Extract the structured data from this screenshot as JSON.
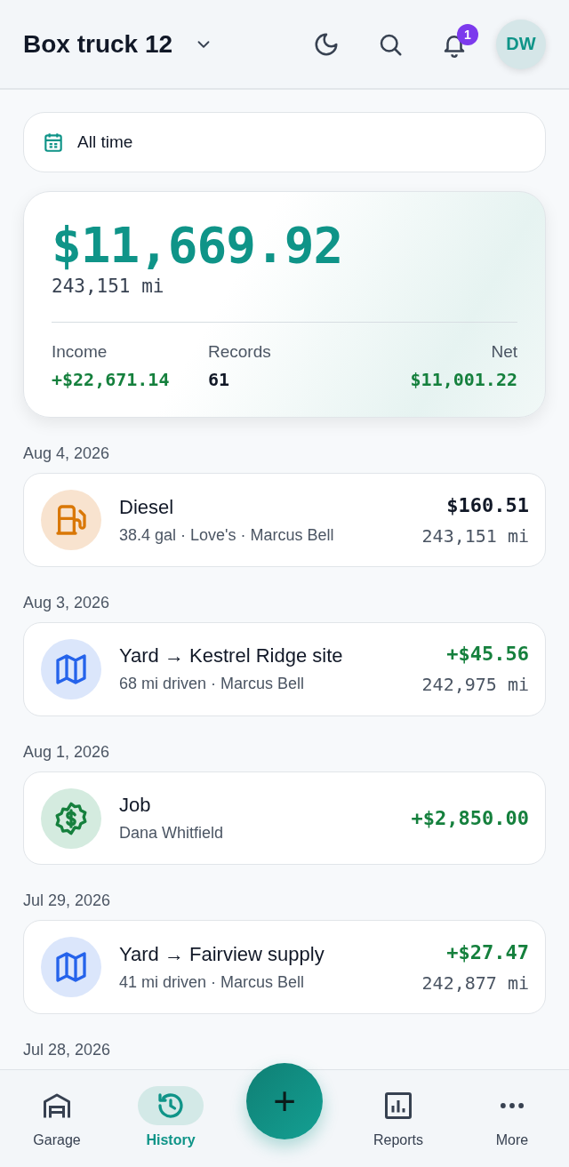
{
  "header": {
    "title": "Box truck 12",
    "notification_count": "1",
    "avatar_initials": "DW"
  },
  "filter": {
    "label": "All time"
  },
  "summary": {
    "total": "$11,669.92",
    "odometer": "243,151 mi",
    "stats": [
      {
        "label": "Income",
        "value": "+$22,671.14",
        "kind": "income"
      },
      {
        "label": "Records",
        "value": "61",
        "kind": "plain"
      },
      {
        "label": "Net",
        "value": "$11,001.22",
        "kind": "income"
      }
    ]
  },
  "groups": [
    {
      "date": "Aug 4, 2026",
      "entries": [
        {
          "kind": "fuel",
          "title": "Diesel",
          "subtitle": "38.4 gal · Love's · Marcus Bell",
          "amount": "$160.51",
          "income": false,
          "odometer": "243,151 mi"
        }
      ]
    },
    {
      "date": "Aug 3, 2026",
      "entries": [
        {
          "kind": "trip",
          "title": "Yard → Kestrel Ridge site",
          "subtitle": "68 mi driven · Marcus Bell",
          "amount": "+$45.56",
          "income": true,
          "odometer": "242,975 mi"
        }
      ]
    },
    {
      "date": "Aug 1, 2026",
      "entries": [
        {
          "kind": "job",
          "title": "Job",
          "subtitle": "Dana Whitfield",
          "amount": "+$2,850.00",
          "income": true
        }
      ]
    },
    {
      "date": "Jul 29, 2026",
      "entries": [
        {
          "kind": "trip",
          "title": "Yard → Fairview supply",
          "subtitle": "41 mi driven · Marcus Bell",
          "amount": "+$27.47",
          "income": true,
          "odometer": "242,877 mi"
        }
      ]
    },
    {
      "date": "Jul 28, 2026"
    }
  ],
  "add_button": {
    "label": "+"
  },
  "nav": {
    "items": [
      {
        "kind": "garage",
        "label": "Garage",
        "selected": false
      },
      {
        "kind": "history",
        "label": "History",
        "selected": true
      },
      {
        "kind": "reports",
        "label": "Reports",
        "selected": false
      },
      {
        "kind": "more",
        "label": "More",
        "selected": false
      }
    ]
  }
}
